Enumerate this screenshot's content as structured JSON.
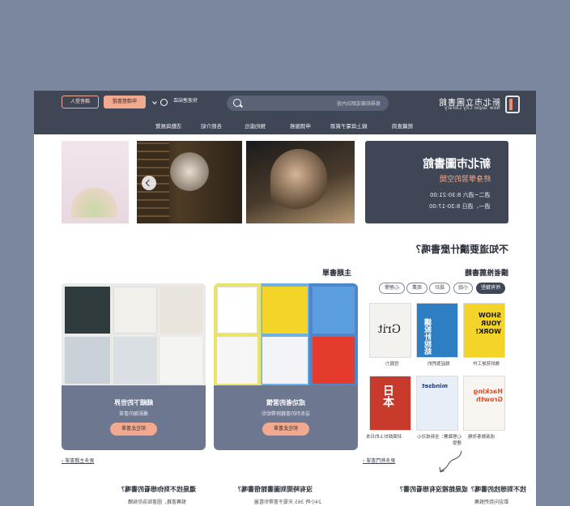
{
  "header": {
    "logo_cn": "新北市立圖書館",
    "logo_en": "New Taipei City Library",
    "search_placeholder": "搜尋館藏或網站內容",
    "util_link": "快速連結區",
    "apply_button": "申請借書證",
    "login_button": "讀者登入",
    "nav": [
      "館藏查詢",
      "線上與電子資源",
      "申請服務",
      "預約座位",
      "各館介紹",
      "活動與展覽"
    ]
  },
  "hero": {
    "title": "新北市圖書館",
    "subtitle": "終身學習的空間",
    "hours1": "週二~週六 8:30-21:00",
    "hours2": "週一、週日 8:30-17:00"
  },
  "recommend": {
    "section_title": "不知道要讀什麼書嗎？",
    "left_title": "讀者推薦書籍",
    "right_title": "主題書單",
    "chips": [
      "所有類型",
      "小說",
      "設計",
      "商業",
      "心理學"
    ],
    "books": [
      {
        "caption": "做好就是工作",
        "color": "#f5d42a",
        "text": "SHOW YOUR WORK!"
      },
      {
        "caption": "掀起我們的",
        "color": "#2e7ec4",
        "text": "讓設計說話"
      },
      {
        "caption": "恆毅力",
        "color": "#f4f2ee",
        "text": "Grit"
      },
      {
        "caption": "成長駭客攻略",
        "color": "#f8f4ef",
        "text": "Hacking Growth"
      },
      {
        "caption": "心態致勝：全新成功心理學",
        "color": "#e8eef8",
        "text": "mindset"
      },
      {
        "caption": "封面設計上的日本",
        "color": "#c73a2c",
        "text": "日本"
      }
    ],
    "more_left": "更多熱門書單 ›",
    "more_right": "更多主題書單 ›"
  },
  "themes": [
    {
      "title": "成功者的習慣",
      "desc": "這系列的書籍將帶給你",
      "button": "前往此書單"
    },
    {
      "title": "細細下的世界",
      "desc": "攝影類的書單",
      "button": "前往此書單"
    }
  ],
  "questions": [
    {
      "title": "找不到想找的書嗎？或是館裡沒有想看的書？",
      "desc": "歡迎向我們推薦"
    },
    {
      "title": "沒有時間到圖書館借書嗎？",
      "desc": "24小時 365 天電子書帶你看遍"
    },
    {
      "title": "還是找不到你想看的書嗎？",
      "desc": "推薦書籍，圖書館為你採購"
    }
  ]
}
